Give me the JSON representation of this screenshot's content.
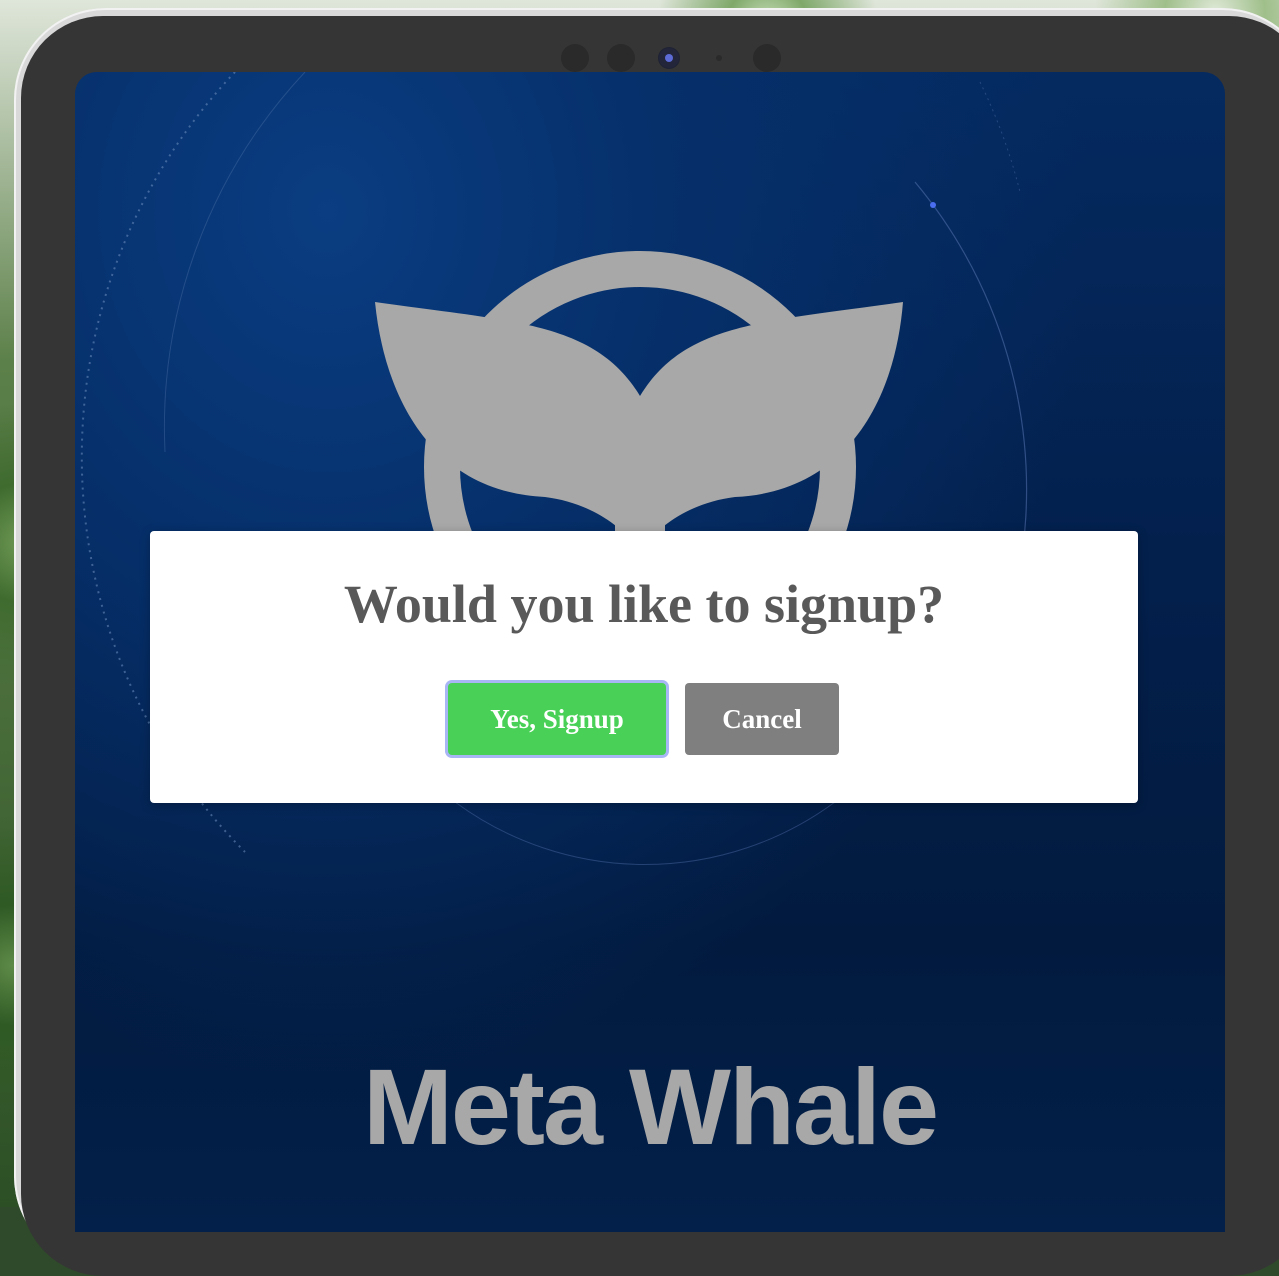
{
  "dialog": {
    "title": "Would you like to signup?",
    "confirm_label": "Yes, Signup",
    "cancel_label": "Cancel"
  },
  "brand": {
    "name": "Meta Whale"
  },
  "colors": {
    "confirm_button": "#48d156",
    "cancel_button": "#7f7f7f",
    "focus_ring": "#a9b6f5",
    "logo": "#a8a8a8",
    "screen_background": "#031f4b"
  },
  "icons": {
    "logo": "whale-tail-logo-icon",
    "device_camera": "camera-lens-icon"
  }
}
